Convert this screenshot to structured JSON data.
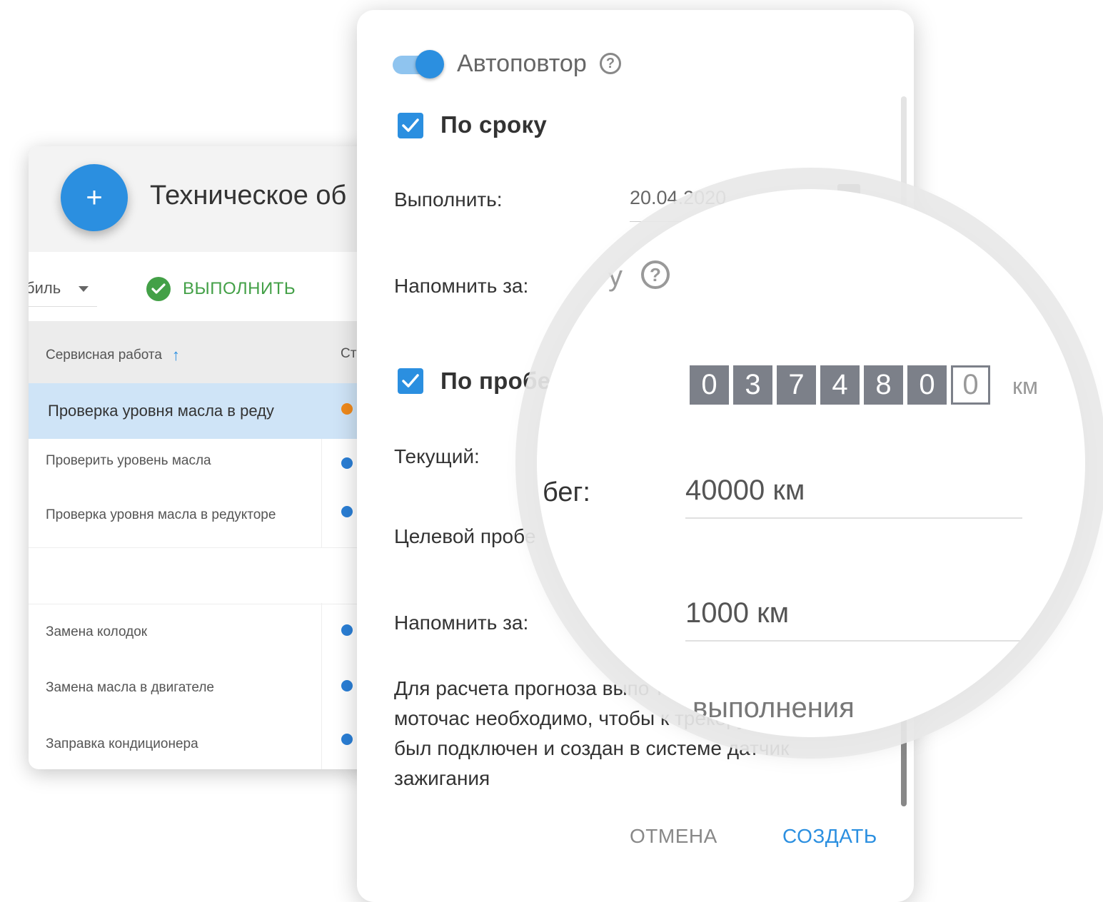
{
  "background_window": {
    "title": "Техническое об",
    "fab_label": "+",
    "filter_value": "биль",
    "execute_label": "ВЫПОЛНИТЬ",
    "columns": [
      "Сервисная работа",
      "Ст"
    ],
    "selected_row": "Проверка уровня масла в реду",
    "rows_group1": [
      "Проверить уровень масла",
      "Проверка уровня масла в редукторе"
    ],
    "rows_group2": [
      "Замена колодок",
      "Замена масла в двигателе",
      "Заправка кондиционера"
    ]
  },
  "dialog": {
    "autorepeat_label": "Автоповтор",
    "by_date": {
      "label": "По сроку",
      "execute_label": "Выполнить:",
      "date_value": "20.04.2020",
      "remind_label": "Напомнить за:",
      "remind_tail": "у"
    },
    "by_mileage": {
      "label": "По пробе",
      "current_label": "Текущий:",
      "target_label": "Целевой пробе",
      "remind_label": "Напомнить за:"
    },
    "info_text": "Для расчета прогноза выпо технической работы по моточас необходимо, чтобы к трекеру автомобиля был подключен и создан в системе датчик зажигания",
    "cancel_label": "ОТМЕНА",
    "create_label": "СОЗДАТЬ"
  },
  "magnifier": {
    "odometer_digits": [
      "0",
      "3",
      "7",
      "4",
      "8",
      "0",
      "0"
    ],
    "odometer_unit": "км",
    "mileage_label_tail": "бег:",
    "target_mileage": "40000 км",
    "remind_mileage": "1000 км",
    "tail_text": "выполнения",
    "remind_tail": "у"
  },
  "colors": {
    "accent_blue": "#2b8fe0",
    "success_green": "#43a047",
    "status_orange": "#f08a1c",
    "status_blue": "#2b7fd6",
    "selected_row": "#cfe4f7"
  },
  "icons": {
    "fab": "plus-icon",
    "execute": "check-circle-icon",
    "sort": "arrow-up-icon",
    "help": "help-circle-icon",
    "calendar": "calendar-icon",
    "checkbox": "checkbox-checked-icon"
  }
}
